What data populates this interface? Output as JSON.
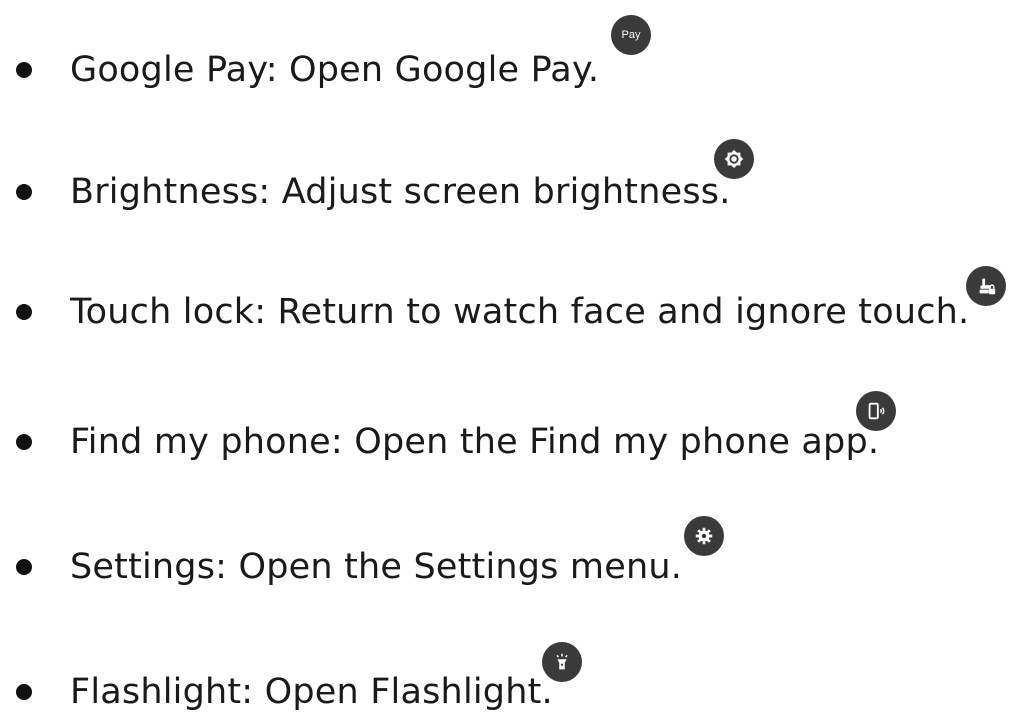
{
  "items": [
    {
      "label": "Google Pay: Open Google Pay.",
      "icon": "pay-icon",
      "icon_text": "Pay"
    },
    {
      "label": "Brightness: Adjust screen brightness.",
      "icon": "brightness-icon"
    },
    {
      "label": "Touch lock: Return to watch face and ignore touch.",
      "icon": "touch-lock-icon"
    },
    {
      "label": "Find my phone: Open the Find my phone app.",
      "icon": "find-phone-icon"
    },
    {
      "label": "Settings: Open the Settings menu.",
      "icon": "gear-icon"
    },
    {
      "label": "Flashlight: Open Flashlight.",
      "icon": "flashlight-icon"
    }
  ],
  "colors": {
    "icon_bg": "#3a3a3a",
    "icon_fg": "#ffffff",
    "bullet": "#111111",
    "text": "#1a1a1a"
  }
}
